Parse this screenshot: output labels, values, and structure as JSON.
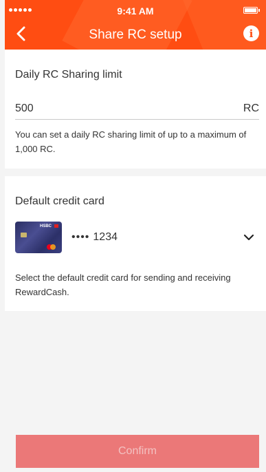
{
  "status_bar": {
    "time": "9:41 AM"
  },
  "header": {
    "title": "Share RC setup",
    "back_icon": "chevron-left-icon",
    "info_icon": "info-icon"
  },
  "limit": {
    "label": "Daily RC Sharing limit",
    "value": "500",
    "unit": "RC",
    "helper": "You can set a daily RC sharing limit of up to a maximum of 1,000 RC."
  },
  "card": {
    "label": "Default credit card",
    "bank_name": "HSBC",
    "masked": "••••",
    "last4": "1234",
    "helper": "Select the default credit card for sending and receiving RewardCash."
  },
  "confirm": {
    "label": "Confirm"
  },
  "colors": {
    "header": "#ff4d12",
    "button": "#eb7878",
    "background": "#f4f4f4"
  }
}
